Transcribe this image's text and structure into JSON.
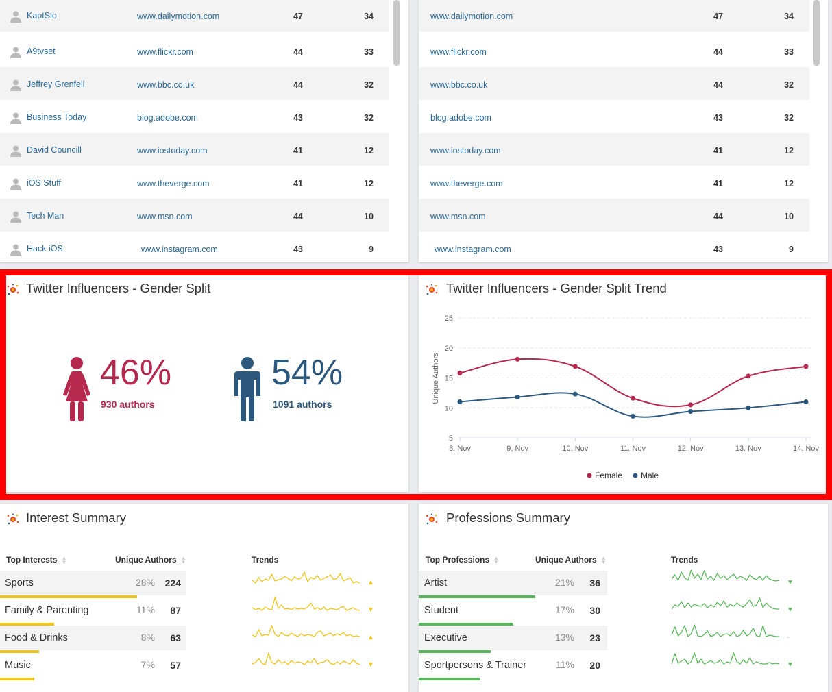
{
  "top_table": {
    "rows": [
      {
        "author": "KaptSlo",
        "site": "www.dailymotion.com",
        "a": "47",
        "b": "34"
      },
      {
        "author": "A9tvset",
        "site": "www.flickr.com",
        "a": "44",
        "b": "33"
      },
      {
        "author": "Jeffrey Grenfell",
        "site": "www.bbc.co.uk",
        "a": "44",
        "b": "32"
      },
      {
        "author": "Business Today",
        "site": "blog.adobe.com",
        "a": "43",
        "b": "32"
      },
      {
        "author": "David Councill",
        "site": "www.iostoday.com",
        "a": "41",
        "b": "12"
      },
      {
        "author": "iOS Stuff",
        "site": "www.theverge.com",
        "a": "41",
        "b": "12"
      },
      {
        "author": "Tech Man",
        "site": "www.msn.com",
        "a": "44",
        "b": "10"
      },
      {
        "author": "Hack iOS",
        "site": "www.instagram.com",
        "a": "43",
        "b": "9"
      }
    ]
  },
  "top_table_right": {
    "rows": [
      {
        "site": "www.dailymotion.com",
        "a": "47",
        "b": "34"
      },
      {
        "site": "www.flickr.com",
        "a": "44",
        "b": "33"
      },
      {
        "site": "www.bbc.co.uk",
        "a": "44",
        "b": "32"
      },
      {
        "site": "blog.adobe.com",
        "a": "43",
        "b": "32"
      },
      {
        "site": "www.iostoday.com",
        "a": "41",
        "b": "12"
      },
      {
        "site": "www.theverge.com",
        "a": "41",
        "b": "12"
      },
      {
        "site": "www.msn.com",
        "a": "44",
        "b": "10"
      },
      {
        "site": "www.instagram.com",
        "a": "43",
        "b": "9"
      }
    ]
  },
  "gender": {
    "title": "Twitter Influencers - Gender Split",
    "female_pct": "46%",
    "female_authors": "930 authors",
    "male_pct": "54%",
    "male_authors": "1091 authors",
    "female_color": "#b5294e",
    "male_color": "#2d587e"
  },
  "trend": {
    "title": "Twitter Influencers - Gender Split Trend"
  },
  "chart_data": {
    "type": "line",
    "title": "Twitter Influencers - Gender Split Trend",
    "xlabel": "",
    "ylabel": "Unique Authors",
    "categories": [
      "8. Nov",
      "9. Nov",
      "10. Nov",
      "11. Nov",
      "12. Nov",
      "13. Nov",
      "14. Nov"
    ],
    "yticks": [
      "5",
      "10",
      "15",
      "20",
      "25"
    ],
    "ylim": [
      5,
      25
    ],
    "grid": true,
    "legend_placement": "bottom",
    "series": [
      {
        "name": "Female",
        "color": "#b5294e",
        "values": [
          15.8,
          18.1,
          16.9,
          11.6,
          10.5,
          15.3,
          16.9
        ]
      },
      {
        "name": "Male",
        "color": "#2d587e",
        "values": [
          11.0,
          11.8,
          12.3,
          8.6,
          9.4,
          10.0,
          11.0
        ]
      }
    ]
  },
  "interest": {
    "title": "Interest Summary",
    "col1": "Top Interests",
    "col2": "Unique Authors",
    "col3": "Trends",
    "bar_color": "#f0c419",
    "rows": [
      {
        "label": "Sports",
        "pct": "28%",
        "val": "224",
        "bar": 0.28,
        "arrow": "▲"
      },
      {
        "label": "Family & Parenting",
        "pct": "11%",
        "val": "87",
        "bar": 0.11,
        "arrow": "▼"
      },
      {
        "label": "Food & Drinks",
        "pct": "8%",
        "val": "63",
        "bar": 0.08,
        "arrow": "▲"
      },
      {
        "label": "Music",
        "pct": "7%",
        "val": "57",
        "bar": 0.07,
        "arrow": "▼"
      }
    ]
  },
  "prof": {
    "title": "Professions Summary",
    "col1": "Top Professions",
    "col2": "Unique Authors",
    "col3": "Trends",
    "bar_color": "#5cb85c",
    "rows": [
      {
        "label": "Artist",
        "pct": "21%",
        "val": "36",
        "bar": 0.21,
        "arrow": "▼"
      },
      {
        "label": "Student",
        "pct": "17%",
        "val": "30",
        "bar": 0.17,
        "arrow": "▼"
      },
      {
        "label": "Executive",
        "pct": "13%",
        "val": "23",
        "bar": 0.13,
        "arrow": "-"
      },
      {
        "label": "Sportpersons & Trainer",
        "pct": "11%",
        "val": "20",
        "bar": 0.11,
        "arrow": "▼"
      }
    ]
  }
}
